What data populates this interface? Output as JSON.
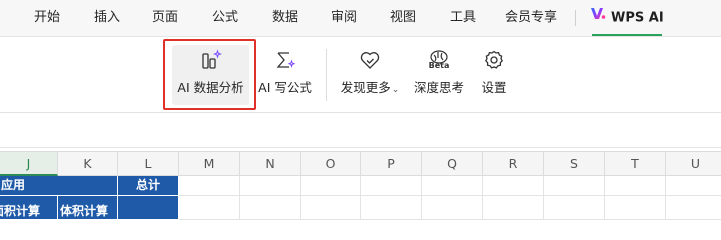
{
  "menu": {
    "tabs": [
      "开始",
      "插入",
      "页面",
      "公式",
      "数据",
      "审阅",
      "视图",
      "工具",
      "会员专享"
    ],
    "ai_tab": "WPS AI"
  },
  "ribbon": {
    "data_analysis": "AI 数据分析",
    "write_formula": "AI 写公式",
    "discover_more": "发现更多",
    "deep_think": "深度思考",
    "deep_think_badge": "Beta",
    "settings": "设置"
  },
  "grid": {
    "columns": [
      "J",
      "K",
      "L",
      "M",
      "N",
      "O",
      "P",
      "Q",
      "R",
      "S",
      "T",
      "U"
    ],
    "selected_column": "J",
    "row1": [
      "应用",
      "",
      "总计"
    ],
    "row2": [
      "面积计算",
      "体积计算",
      ""
    ]
  },
  "colors": {
    "accent_green": "#2aa35a",
    "highlight_red": "#e0302a",
    "header_blue": "#1f5aa8"
  }
}
